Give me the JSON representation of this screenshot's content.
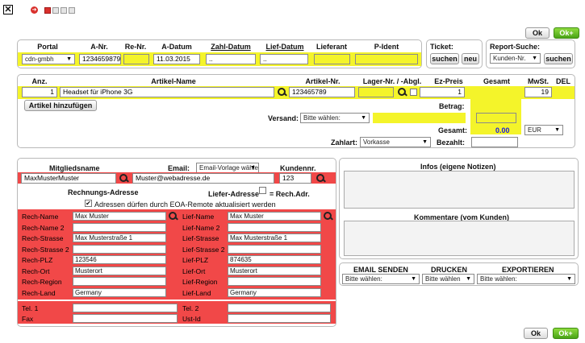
{
  "toolbar": {
    "close_icon": "x-box-icon",
    "pages": [
      "1",
      "2",
      "3"
    ],
    "ok_label": "Ok",
    "okplus_label": "Ok+"
  },
  "header": {
    "cols": {
      "portal": "Portal",
      "anr": "A-Nr.",
      "renr": "Re-Nr.",
      "adatum": "A-Datum",
      "zahldatum": "Zahl-Datum",
      "liefdatum": "Lief-Datum",
      "lieferant": "Lieferant",
      "pident": "P-Ident"
    },
    "values": {
      "portal": "cdn-gmbh",
      "anr": "1234659879",
      "adatum": "11.03.2015",
      "zahldatum": "..",
      "liefdatum": ".."
    },
    "ticket": {
      "label": "Ticket:",
      "search": "suchen",
      "new": "neu"
    },
    "report": {
      "label": "Report-Suche:",
      "select": "Kunden-Nr.",
      "search": "suchen"
    }
  },
  "articles": {
    "cols": {
      "anz": "Anz.",
      "name": "Artikel-Name",
      "nr": "Artikel-Nr.",
      "lager": "Lager-Nr. / -Abgl.",
      "ezpreis": "Ez-Preis",
      "gesamt": "Gesamt",
      "mwst": "MwSt.",
      "del": "DEL"
    },
    "row": {
      "anz": "1",
      "name": "Headset für iPhone 3G",
      "nr": "123465789",
      "ezpreis": "1",
      "mwst": "19"
    },
    "add_label": "Artikel hinzufügen",
    "betrag_label": "Betrag:",
    "versand_label": "Versand:",
    "versand_select": "Bitte wählen:",
    "gesamt_label": "Gesamt:",
    "gesamt_value": "0.00",
    "currency": "EUR",
    "zahlart_label": "Zahlart:",
    "zahlart_select": "Vorkasse",
    "bezahlt_label": "Bezahlt:"
  },
  "customer": {
    "mitglied_label": "Mitgliedsname",
    "mitglied_value": "MaxMusterMuster",
    "email_label": "Email:",
    "email_select": "Email-Vorlage wählen",
    "email_value": "Muster@webadresse.de",
    "kundennr_label": "Kundennr.",
    "kundennr_value": "123",
    "rech_title": "Rechnungs-Adresse",
    "lief_title": "Liefer-Adresse",
    "rech_same": "= Rech.Adr.",
    "eoa_note": "Adressen dürfen durch EOA-Remote aktualisiert werden",
    "rech_rows": [
      {
        "label": "Rech-Name",
        "value": "Max Muster"
      },
      {
        "label": "Rech-Name 2",
        "value": ""
      },
      {
        "label": "Rech-Strasse",
        "value": "Max Musterstraße 1"
      },
      {
        "label": "Rech-Strasse 2",
        "value": ""
      },
      {
        "label": "Rech-PLZ",
        "value": "123546"
      },
      {
        "label": "Rech-Ort",
        "value": "Musterort"
      },
      {
        "label": "Rech-Region",
        "value": ""
      },
      {
        "label": "Rech-Land",
        "value": "Germany"
      }
    ],
    "lief_rows": [
      {
        "label": "Lief-Name",
        "value": "Max Muster"
      },
      {
        "label": "Lief-Name 2",
        "value": ""
      },
      {
        "label": "Lief-Strasse",
        "value": "Max Musterstraße 1"
      },
      {
        "label": "Lief-Strasse 2",
        "value": ""
      },
      {
        "label": "Lief-PLZ",
        "value": "874635"
      },
      {
        "label": "Lief-Ort",
        "value": "Musterort"
      },
      {
        "label": "Lief-Region",
        "value": ""
      },
      {
        "label": "Lief-Land",
        "value": "Germany"
      }
    ],
    "tel1_label": "Tel. 1",
    "tel2_label": "Tel. 2",
    "fax_label": "Fax",
    "ustid_label": "Ust-Id"
  },
  "notes": {
    "infos_title": "Infos (eigene Notizen)",
    "komm_title": "Kommentare (vom Kunden)"
  },
  "actions": {
    "email_title": "EMAIL SENDEN",
    "drucken_title": "DRUCKEN",
    "export_title": "EXPORTIEREN",
    "email_select": "Bitte wählen:",
    "drucken_select": "Bitte wählen",
    "export_select": "Bitte wählen:"
  },
  "colors": {
    "yellow": "#f4f42a",
    "red": "#f14848",
    "green": "#5bb51d"
  }
}
